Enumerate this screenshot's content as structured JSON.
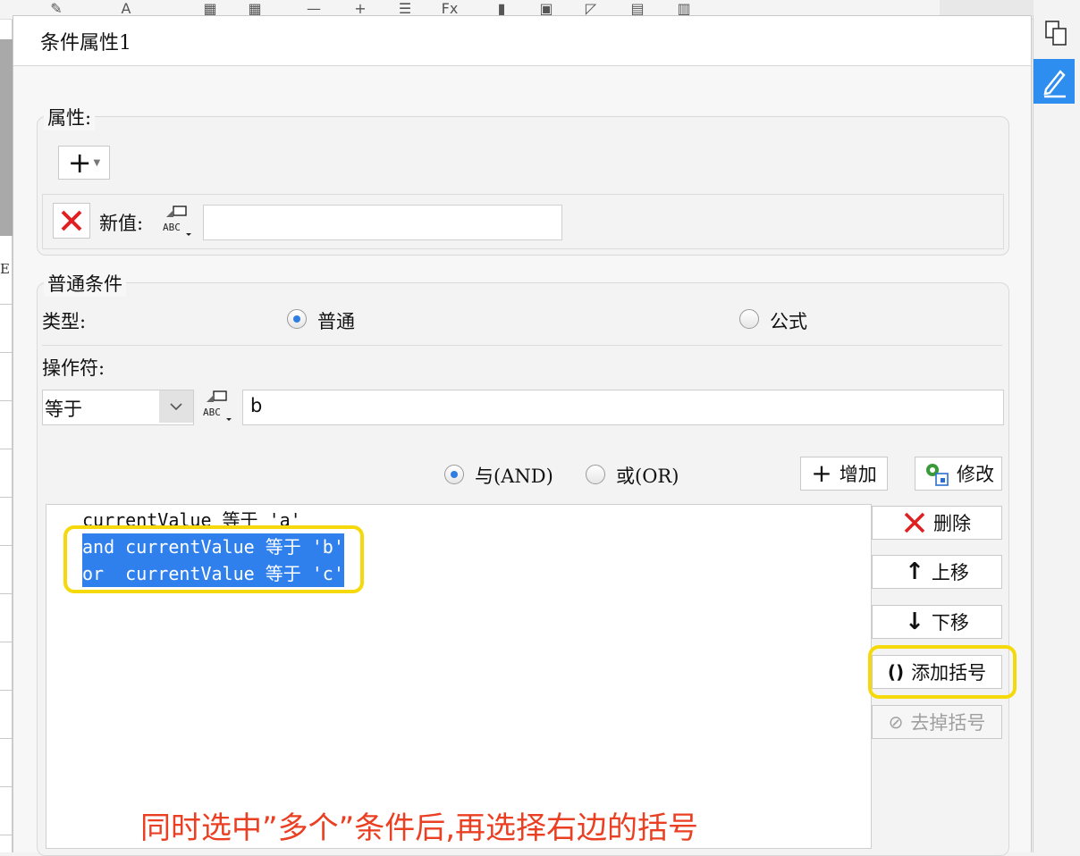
{
  "dialog": {
    "title": "条件属性1",
    "properties": {
      "legend": "属性:",
      "new_value_label": "新值:",
      "new_value": ""
    },
    "condition": {
      "legend": "普通条件",
      "type_label": "类型:",
      "type_options": [
        "普通",
        "公式"
      ],
      "type_selected": "普通",
      "operator_label": "操作符:",
      "operator_value": "等于",
      "value_input": "b",
      "logic_options": [
        "与(AND)",
        "或(OR)"
      ],
      "logic_selected": "与(AND)",
      "add_label": "增加",
      "modify_label": "修改",
      "delete_label": "删除",
      "move_up_label": "上移",
      "move_down_label": "下移",
      "add_bracket_label": "添加括号",
      "remove_bracket_label": "去掉括号",
      "conditions": [
        "currentValue 等于 'a'",
        "and currentValue 等于 'b'",
        "or  currentValue 等于 'c'"
      ]
    }
  },
  "annotation": "同时选中”多个”条件后,再选择右边的括号",
  "left_edge_text": "E",
  "colors": {
    "selection": "#2f80ed",
    "highlight": "#f5d90a",
    "annotation": "#ea3f22",
    "delete_icon": "#e02020",
    "edit_tab": "#2d8ef0"
  }
}
